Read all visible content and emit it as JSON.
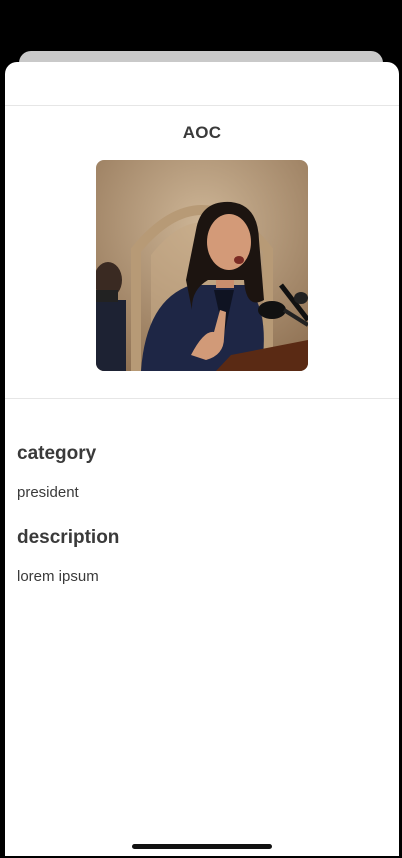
{
  "sheet": {
    "title": "AOC",
    "photo_icon": "person-photo",
    "fields": [
      {
        "label": "category",
        "value": "president"
      },
      {
        "label": "description",
        "value": "lorem ipsum"
      }
    ]
  }
}
